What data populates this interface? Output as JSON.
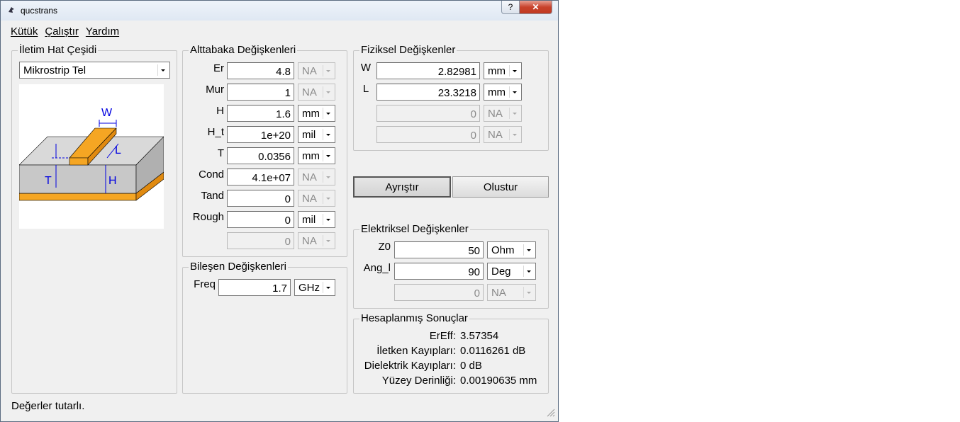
{
  "window": {
    "title": "qucstrans",
    "help_label": "?",
    "close_label": "✕"
  },
  "menu": [
    "Kütük",
    "Çalıştır",
    "Yardım"
  ],
  "line_type": {
    "title": "İletim Hat Çeşidi",
    "selected": "Mikrostrip Tel",
    "diagram_labels": {
      "w": "W",
      "l": "L",
      "t": "T",
      "h": "H"
    }
  },
  "substrate": {
    "title": "Alttabaka Değişkenleri",
    "rows": [
      {
        "label": "Er",
        "value": "4.8",
        "unit": "NA",
        "unit_enabled": false
      },
      {
        "label": "Mur",
        "value": "1",
        "unit": "NA",
        "unit_enabled": false
      },
      {
        "label": "H",
        "value": "1.6",
        "unit": "mm",
        "unit_enabled": true
      },
      {
        "label": "H_t",
        "value": "1e+20",
        "unit": "mil",
        "unit_enabled": true
      },
      {
        "label": "T",
        "value": "0.0356",
        "unit": "mm",
        "unit_enabled": true
      },
      {
        "label": "Cond",
        "value": "4.1e+07",
        "unit": "NA",
        "unit_enabled": false
      },
      {
        "label": "Tand",
        "value": "0",
        "unit": "NA",
        "unit_enabled": false
      },
      {
        "label": "Rough",
        "value": "0",
        "unit": "mil",
        "unit_enabled": true
      },
      {
        "label": "",
        "value": "0",
        "unit": "NA",
        "unit_enabled": false,
        "value_enabled": false
      }
    ]
  },
  "component": {
    "title": "Bileşen Değişkenleri",
    "label": "Freq",
    "value": "1.7",
    "unit": "GHz"
  },
  "physical": {
    "title": "Fiziksel Değişkenler",
    "rows": [
      {
        "label": "W",
        "value": "2.82981",
        "unit": "mm",
        "enabled": true
      },
      {
        "label": "L",
        "value": "23.3218",
        "unit": "mm",
        "enabled": true
      },
      {
        "label": "",
        "value": "0",
        "unit": "NA",
        "enabled": false
      },
      {
        "label": "",
        "value": "0",
        "unit": "NA",
        "enabled": false
      }
    ]
  },
  "actions": {
    "analyze": "Ayrıştır",
    "synthesize": "Olustur"
  },
  "electrical": {
    "title": "Elektriksel Değişkenler",
    "rows": [
      {
        "label": "Z0",
        "value": "50",
        "unit": "Ohm",
        "enabled": true
      },
      {
        "label": "Ang_l",
        "value": "90",
        "unit": "Deg",
        "enabled": true
      },
      {
        "label": "",
        "value": "0",
        "unit": "NA",
        "enabled": false
      }
    ]
  },
  "results": {
    "title": "Hesaplanmış Sonuçlar",
    "rows": [
      {
        "label": "ErEff:",
        "value": "3.57354"
      },
      {
        "label": "İletken Kayıpları:",
        "value": "0.0116261 dB"
      },
      {
        "label": "Dielektrik Kayıpları:",
        "value": "0 dB"
      },
      {
        "label": "Yüzey Derinliği:",
        "value": "0.00190635 mm"
      }
    ]
  },
  "status": "Değerler tutarlı.",
  "colors": {
    "copper": "#f5a623",
    "substrate": "#c8c8c8",
    "dimension": "#0000e0"
  }
}
